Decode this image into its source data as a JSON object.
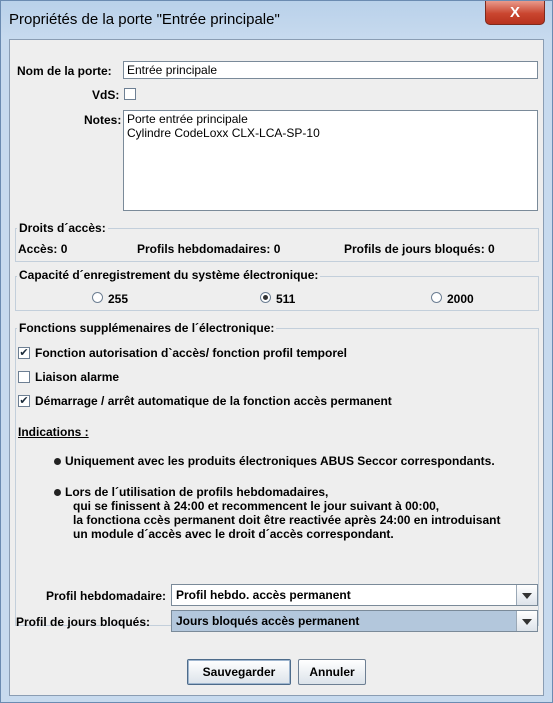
{
  "window": {
    "title": "Propriétés de la porte \"Entrée principale\"",
    "close_label": "X"
  },
  "form": {
    "door_name_label": "Nom de la porte:",
    "door_name_value": "Entrée principale",
    "vds_label": "VdS:",
    "notes_label": "Notes:",
    "notes_value": "Porte entrée principale\nCylindre CodeLoxx CLX-LCA-SP-10"
  },
  "access_rights": {
    "title": "Droits d´accès:",
    "acces": "Accès: 0",
    "weekly_profiles": "Profils hebdomadaires: 0",
    "blocked_day_profiles": "Profils de jours bloqués: 0"
  },
  "capacity": {
    "title": "Capacité d´enregistrement du système électronique:",
    "options": [
      {
        "label": "255",
        "selected": false
      },
      {
        "label": "511",
        "selected": true
      },
      {
        "label": "2000",
        "selected": false
      }
    ]
  },
  "functions": {
    "title": "Fonctions supplémenaires de l´électronique:",
    "checkboxes": [
      {
        "label": "Fonction autorisation d`accès/ fonction profil temporel",
        "checked": true
      },
      {
        "label": "Liaison alarme",
        "checked": false
      },
      {
        "label": "Démarrage / arrêt automatique de la fonction accès permanent",
        "checked": true
      }
    ],
    "indications_label": "Indications :",
    "bullet1": "Uniquement avec les produits électroniques ABUS Seccor correspondants.",
    "bullet2_lines": [
      "Lors de l´utilisation de profils hebdomadaires,",
      "qui se finissent à 24:00 et recommencent le jour suivant à 00:00,",
      "la fonctiona ccès permanent doit être reactivée après 24:00 en introduisant",
      "un module d´accès avec le droit d´accès correspondant."
    ]
  },
  "profiles": {
    "weekly_label": "Profil hebdomadaire:",
    "weekly_value": "Profil hebdo. accès permanent",
    "blocked_label": "Profil de jours bloqués:",
    "blocked_value": "Jours bloqués accès permanent"
  },
  "buttons": {
    "save": "Sauvegarder",
    "cancel": "Annuler"
  },
  "check_mark": "✔"
}
